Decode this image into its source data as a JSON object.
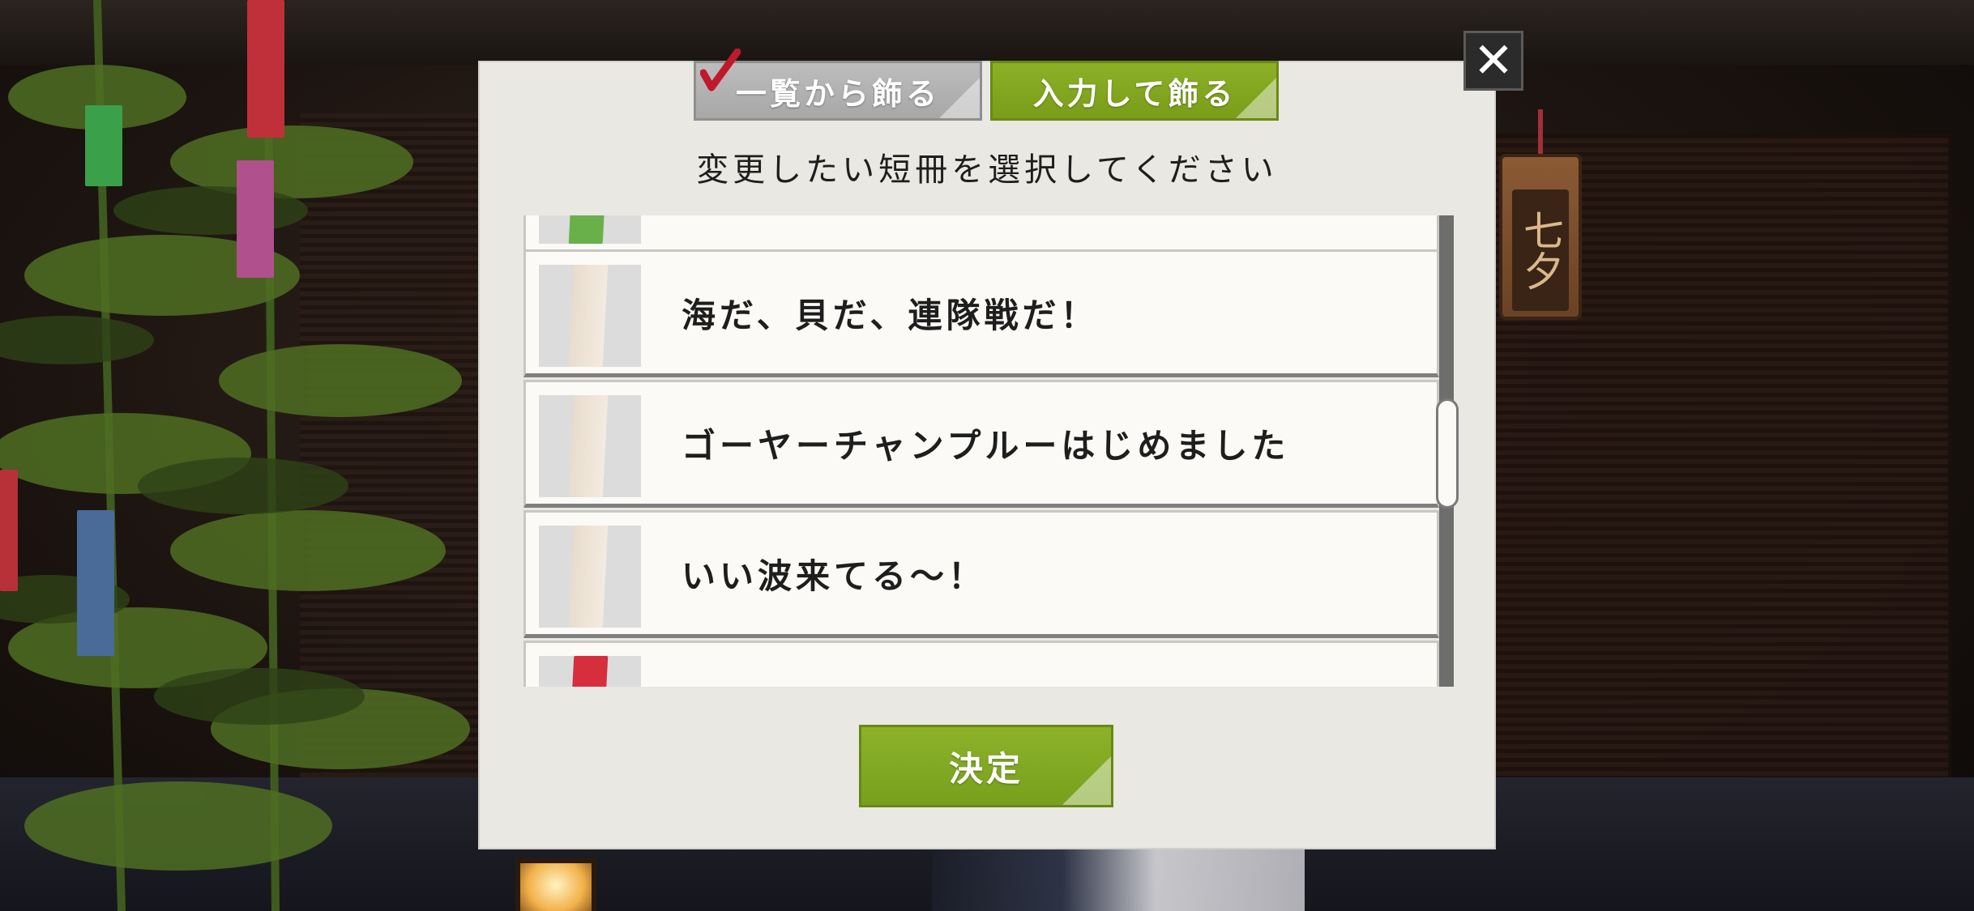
{
  "tabs": {
    "list_label": "一覧から飾る",
    "input_label": "入力して飾る"
  },
  "close_label": "✕",
  "prompt": "変更したい短冊を選択してください",
  "plaque_text": "七夕",
  "tanzaku_list": [
    {
      "text": "",
      "color": "#6ab04a"
    },
    {
      "text": "海だ、貝だ、連隊戦だ！",
      "color": "#efe6da"
    },
    {
      "text": "ゴーヤーチャンプルーはじめました",
      "color": "#efe6da"
    },
    {
      "text": "いい波来てる～！",
      "color": "#efe6da"
    },
    {
      "text": "",
      "color": "#d62e3c"
    }
  ],
  "confirm_label": "決定",
  "colors": {
    "accent_green": "#7fa61f",
    "tab_gray": "#b0b0b0",
    "dialog_bg": "#eae8e2",
    "check_red": "#c0192b"
  }
}
